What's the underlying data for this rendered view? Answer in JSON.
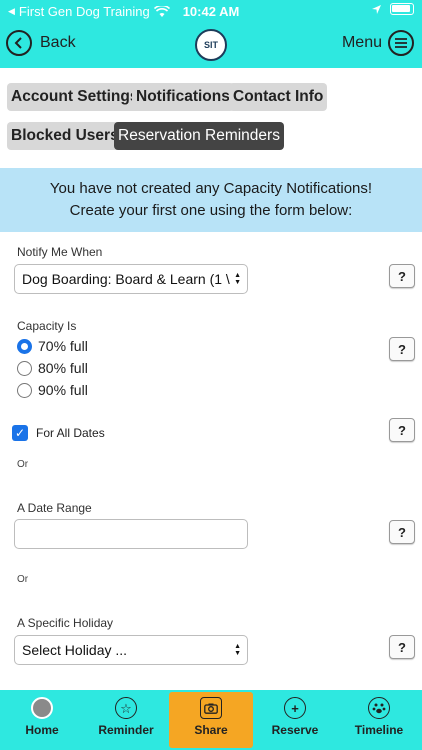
{
  "status_bar": {
    "carrier": "First Gen Dog Training",
    "time": "10:42 AM"
  },
  "nav": {
    "back_label": "Back",
    "logo_text": "SIT",
    "menu_label": "Menu"
  },
  "tabs": [
    {
      "label": "Account Settings"
    },
    {
      "label": "Notifications"
    },
    {
      "label": "Contact Info"
    },
    {
      "label": "Blocked Users"
    },
    {
      "label": "Reservation Reminders"
    }
  ],
  "banner": {
    "line1": "You have not created any Capacity Notifications!",
    "line2": "Create your first one using the form below:"
  },
  "form": {
    "notify_label": "Notify Me When",
    "notify_value": "Dog Boarding: Board & Learn (1 \\",
    "capacity_label": "Capacity Is",
    "capacity_options": [
      {
        "label": "70% full",
        "selected": true
      },
      {
        "label": "80% full",
        "selected": false
      },
      {
        "label": "90% full",
        "selected": false
      }
    ],
    "all_dates_label": "For All Dates",
    "all_dates_checked": true,
    "or_1": "Or",
    "date_range_label": "A Date Range",
    "date_range_value": "",
    "or_2": "Or",
    "holiday_label": "A Specific Holiday",
    "holiday_value": "Select Holiday ...",
    "help": "?"
  },
  "bottom_tabs": [
    {
      "label": "Home",
      "icon": "avatar-icon"
    },
    {
      "label": "Reminder",
      "icon": "star-icon"
    },
    {
      "label": "Share",
      "icon": "camera-icon",
      "active": true
    },
    {
      "label": "Reserve",
      "icon": "plus-icon"
    },
    {
      "label": "Timeline",
      "icon": "paw-icon"
    }
  ],
  "colors": {
    "accent": "#2ee8e0",
    "active_tab": "#f5a623",
    "banner": "#b8e3f7",
    "selected_control": "#1a73e8"
  }
}
